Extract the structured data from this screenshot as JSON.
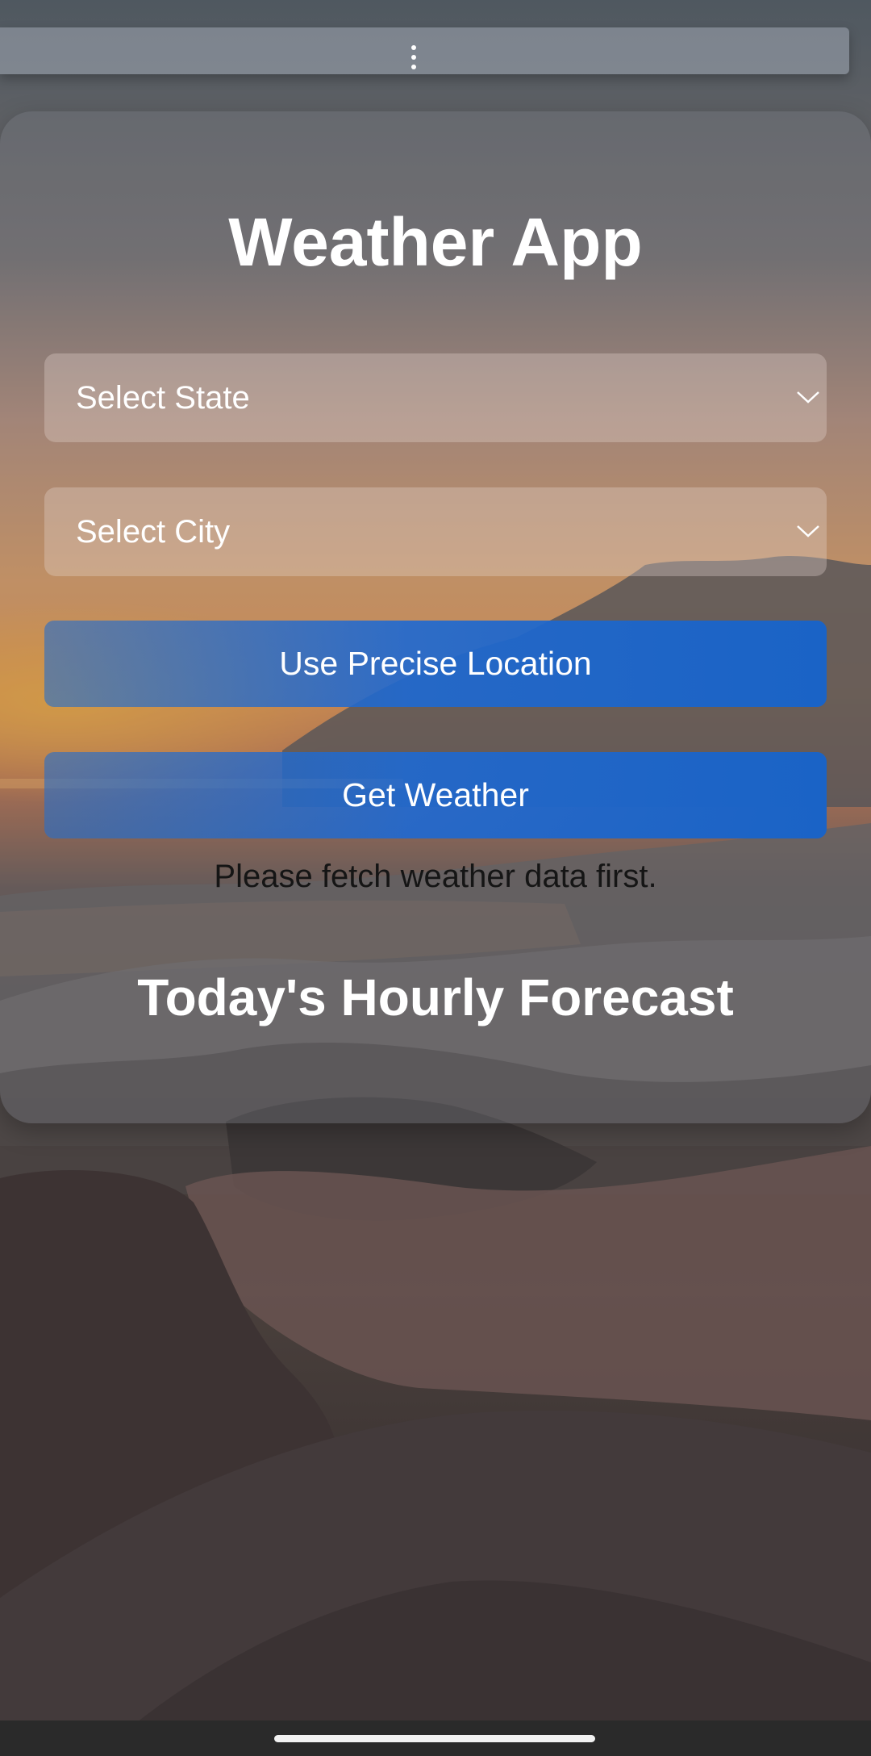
{
  "app": {
    "title": "Weather App"
  },
  "state_select": {
    "label": "Select State",
    "icon": "chevron-down-icon"
  },
  "city_select": {
    "label": "Select City",
    "icon": "chevron-down-icon"
  },
  "buttons": {
    "precise_location": "Use Precise Location",
    "get_weather": "Get Weather"
  },
  "status_message": "Please fetch weather data first.",
  "forecast": {
    "heading": "Today's Hourly Forecast"
  },
  "colors": {
    "button_blue": "#1a63c6",
    "text_white": "#ffffff",
    "status_text": "#151515"
  }
}
